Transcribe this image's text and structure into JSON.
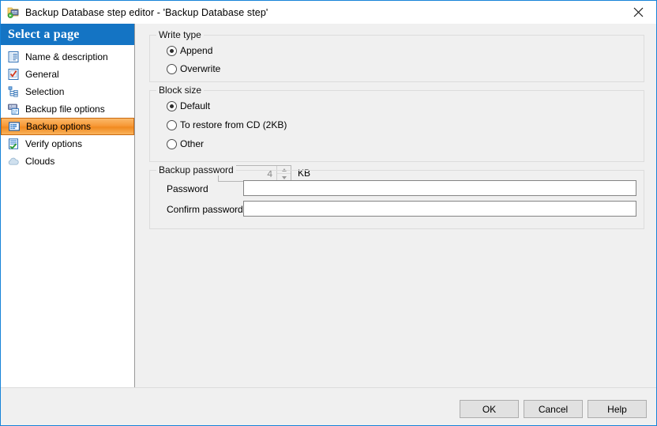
{
  "window": {
    "title": "Backup Database step editor - 'Backup Database step'",
    "icon": "backup-database-icon",
    "close_label": "×",
    "accent_border": "#1683d8"
  },
  "sidebar": {
    "header": "Select a page",
    "header_color": "#1474c4",
    "selected_color": "#f79937",
    "items": [
      {
        "label": "Name & description",
        "icon": "description-list-icon",
        "selected": false
      },
      {
        "label": "General",
        "icon": "checkmark-form-icon",
        "selected": false
      },
      {
        "label": "Selection",
        "icon": "tree-selection-icon",
        "selected": false
      },
      {
        "label": "Backup file options",
        "icon": "backup-file-icon",
        "selected": false
      },
      {
        "label": "Backup options",
        "icon": "backup-options-icon",
        "selected": true
      },
      {
        "label": "Verify options",
        "icon": "verify-check-icon",
        "selected": false
      },
      {
        "label": "Clouds",
        "icon": "cloud-icon",
        "selected": false
      }
    ]
  },
  "main": {
    "write_type": {
      "title": "Write type",
      "options": [
        {
          "label": "Append",
          "checked": true
        },
        {
          "label": "Overwrite",
          "checked": false
        }
      ]
    },
    "block_size": {
      "title": "Block size",
      "options": [
        {
          "label": "Default",
          "checked": true
        },
        {
          "label": "To restore from CD (2KB)",
          "checked": false
        },
        {
          "label": "Other",
          "checked": false
        }
      ],
      "spinner_value": "4",
      "spinner_unit": "KB",
      "spinner_disabled": true
    },
    "backup_password": {
      "title": "Backup password",
      "password_label": "Password",
      "password_value": "",
      "confirm_label": "Confirm password",
      "confirm_value": ""
    }
  },
  "footer": {
    "ok_label": "OK",
    "cancel_label": "Cancel",
    "help_label": "Help"
  }
}
